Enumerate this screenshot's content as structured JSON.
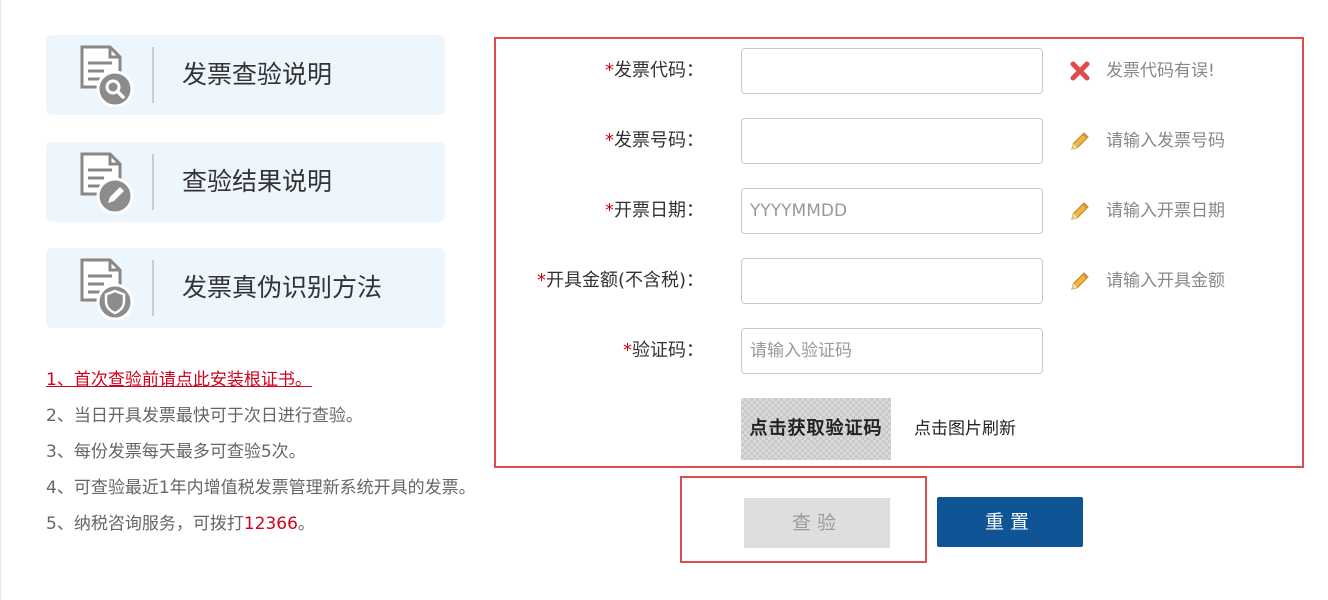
{
  "cards": [
    {
      "label": "发票查验说明",
      "icon": "document-search-icon"
    },
    {
      "label": "查验结果说明",
      "icon": "document-edit-icon"
    },
    {
      "label": "发票真伪识别方法",
      "icon": "document-shield-icon"
    }
  ],
  "notes": {
    "n1_link": "1、首次查验前请点此安装根证书。",
    "n2": "2、当日开具发票最快可于次日进行查验。",
    "n3": "3、每份发票每天最多可查验5次。",
    "n4": "4、可查验最近1年内增值税发票管理新系统开具的发票。",
    "n5_prefix": "5、纳税咨询服务，可拨打",
    "n5_phone": "12366",
    "n5_suffix": "。"
  },
  "form": {
    "required_mark": "*",
    "invoice_code": {
      "label": "发票代码：",
      "value": "",
      "placeholder": "",
      "hint": "发票代码有误!",
      "hint_icon": "error-x-icon"
    },
    "invoice_number": {
      "label": "发票号码：",
      "value": "",
      "placeholder": "",
      "hint": "请输入发票号码",
      "hint_icon": "pencil-icon"
    },
    "issue_date": {
      "label": "开票日期：",
      "value": "",
      "placeholder": "YYYYMMDD",
      "hint": "请输入开票日期",
      "hint_icon": "pencil-icon"
    },
    "amount": {
      "label": "开具金额(不含税)：",
      "value": "",
      "placeholder": "",
      "hint": "请输入开具金额",
      "hint_icon": "pencil-icon"
    },
    "captcha": {
      "label": "验证码：",
      "value": "",
      "placeholder": "请输入验证码"
    },
    "captcha_image_text": "点击获取验证码",
    "captcha_refresh": "点击图片刷新"
  },
  "buttons": {
    "query": "查验",
    "reset": "重置"
  },
  "colors": {
    "card_bg": "#edf5fd",
    "required_red": "#d0021b",
    "frame_red": "#e04a4a",
    "reset_blue": "#0f5596",
    "query_disabled": "#dedede"
  }
}
